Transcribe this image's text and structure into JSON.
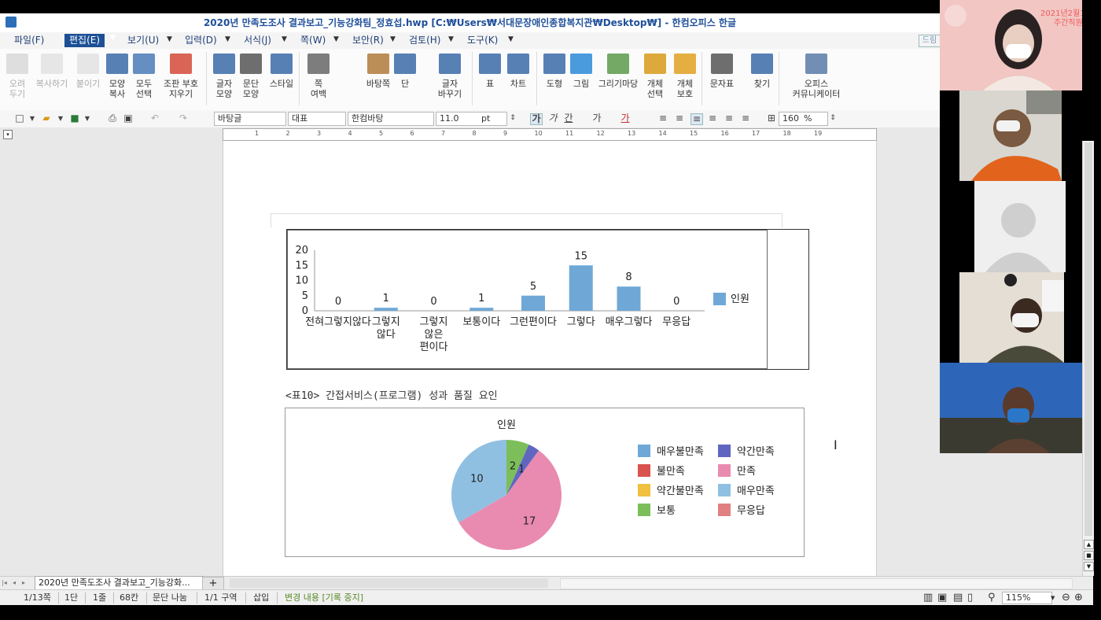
{
  "window": {
    "title": "2020년 만족도조사 결과보고_기능강화팀_정효섭.hwp [C:₩Users₩서대문장애인종합복지관₩Desktop₩] - 한컴오피스 한글"
  },
  "menu": {
    "items": [
      "파일(F)",
      "편집(E)",
      "보기(U)",
      "입력(D)",
      "서식(J)",
      "쪽(W)",
      "보안(R)",
      "검토(H)",
      "도구(K)"
    ],
    "ribbon_toggle": "드림"
  },
  "toolbar": {
    "buttons": [
      {
        "label": "오려\n두기",
        "icon": "scissors-icon"
      },
      {
        "label": "복사하기",
        "icon": "copy-icon"
      },
      {
        "label": "붙이기",
        "icon": "paste-icon"
      },
      {
        "label": "모양\n복사",
        "icon": "format-painter-icon"
      },
      {
        "label": "모두\n선택",
        "icon": "select-all-icon"
      },
      {
        "label": "조판 부호\n지우기",
        "icon": "clear-codes-icon"
      },
      {
        "label": "글자\n모양",
        "icon": "char-shape-icon"
      },
      {
        "label": "문단\n모양",
        "icon": "para-shape-icon"
      },
      {
        "label": "스타일",
        "icon": "style-icon"
      },
      {
        "label": "쪽\n여백",
        "icon": "page-margin-icon"
      },
      {
        "label": "바탕쪽",
        "icon": "master-page-icon"
      },
      {
        "label": "단",
        "icon": "columns-icon"
      },
      {
        "label": "글자\n바꾸기",
        "icon": "char-replace-icon"
      },
      {
        "label": "표",
        "icon": "table-icon"
      },
      {
        "label": "차트",
        "icon": "chart-icon"
      },
      {
        "label": "도형",
        "icon": "shape-icon"
      },
      {
        "label": "그림",
        "icon": "picture-icon"
      },
      {
        "label": "그리기마당",
        "icon": "clipart-icon"
      },
      {
        "label": "개체\n선택",
        "icon": "object-select-icon"
      },
      {
        "label": "개체\n보호",
        "icon": "object-protect-icon"
      },
      {
        "label": "문자표",
        "icon": "symbol-icon"
      },
      {
        "label": "찾기",
        "icon": "find-icon"
      },
      {
        "label": "오피스\n커뮤니케이터",
        "icon": "communicator-icon"
      }
    ]
  },
  "format": {
    "style": "바탕글",
    "lang": "대표",
    "font": "한컴바탕",
    "size": "11.0",
    "unit": "pt",
    "bold": "가",
    "italic": "가",
    "underline": "간",
    "strike": "가",
    "color": "가",
    "zoom_value": "160",
    "zoom_unit": "%"
  },
  "ruler": {
    "numbers": [
      "1",
      "2",
      "3",
      "4",
      "5",
      "6",
      "7",
      "8",
      "9",
      "10",
      "11",
      "12",
      "13",
      "14",
      "15",
      "16",
      "17",
      "18",
      "19"
    ]
  },
  "document": {
    "caption": "<표10> 간접서비스(프로그램) 성과 품질 요인"
  },
  "chart_data": [
    {
      "type": "bar",
      "categories": [
        "전혀그렇지않다",
        "그렇지\n않다",
        "그렇지\n않은\n편이다",
        "보통이다",
        "그런편이다",
        "그렇다",
        "매우그렇다",
        "무응답"
      ],
      "values": [
        0,
        1,
        0,
        1,
        5,
        15,
        8,
        0
      ],
      "series": [
        {
          "name": "인원",
          "values": [
            0,
            1,
            0,
            1,
            5,
            15,
            8,
            0
          ]
        }
      ],
      "ylim": [
        0,
        20
      ],
      "yticks": [
        0,
        5,
        10,
        15,
        20
      ],
      "legend": "right",
      "color": "#6fa8d6"
    },
    {
      "type": "pie",
      "title": "인원",
      "slices": [
        {
          "name": "매우불만족",
          "value": 0,
          "color": "#6fa8d6"
        },
        {
          "name": "약간만족",
          "value": 1,
          "color": "#6066c0"
        },
        {
          "name": "불만족",
          "value": 0,
          "color": "#d9534f"
        },
        {
          "name": "만족",
          "value": 17,
          "color": "#e98bb0"
        },
        {
          "name": "약간불만족",
          "value": 0,
          "color": "#f0c040"
        },
        {
          "name": "매우만족",
          "value": 10,
          "color": "#8fc0e2"
        },
        {
          "name": "보통",
          "value": 2,
          "color": "#7cbf5a"
        },
        {
          "name": "무응답",
          "value": 0,
          "color": "#e08080"
        }
      ],
      "legend": "right"
    }
  ],
  "doc_tab": {
    "label": "2020년 만족도조사 결과보고_기능강화..."
  },
  "status": {
    "page": "1/13쪽",
    "column": "1단",
    "line": "1줄",
    "char": "68칸",
    "para": "문단 나눔",
    "section": "1/1 구역",
    "mode": "삽입",
    "track": "변경 내용 [기록 중지]",
    "zoom": "115%"
  },
  "participants": {
    "banner_text": "2021년2월16일\n주간직원교육"
  }
}
